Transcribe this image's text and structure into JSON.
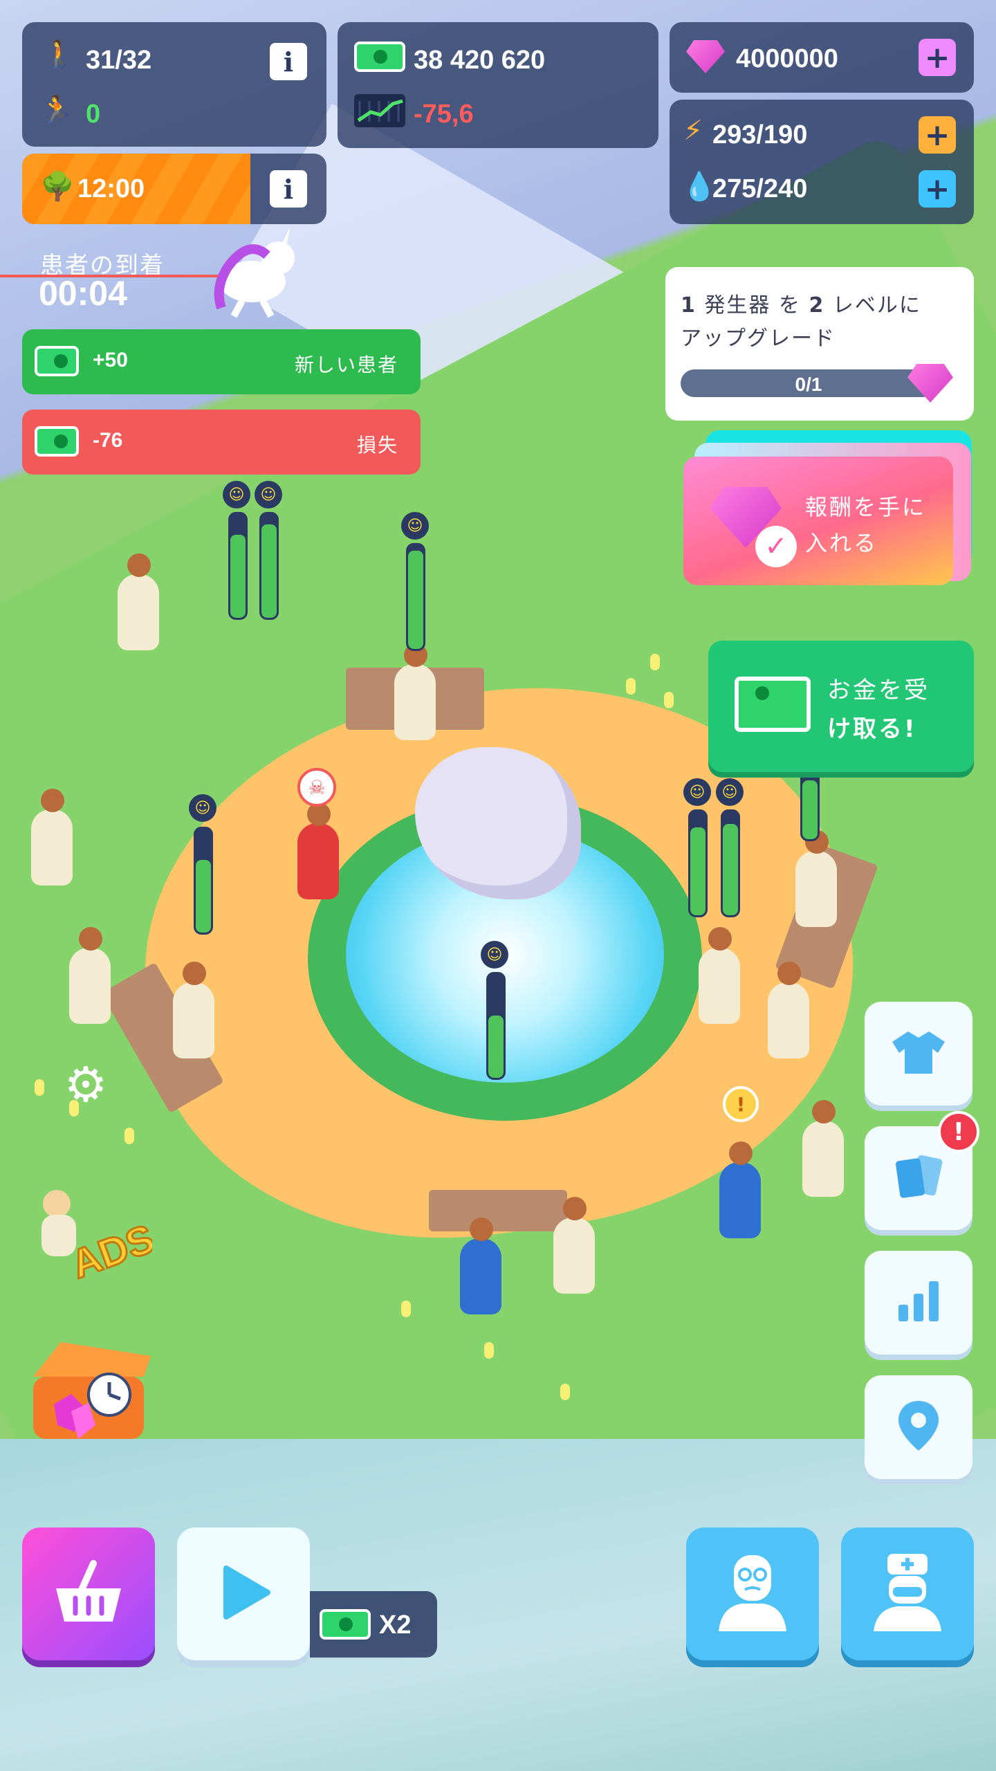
{
  "hud": {
    "patients": "31/32",
    "patients_cured": "0",
    "money": "38 420 620",
    "money_rate": "-75,6",
    "gems": "4000000",
    "energy": "293/190",
    "water": "275/240",
    "timer": "12:00",
    "info_glyph": "i",
    "plus_glyph": "+"
  },
  "arrival": {
    "label": "患者の到着",
    "time": "00:04"
  },
  "banners": {
    "new_patient_amount": "+50",
    "new_patient_label": "新しい患者",
    "loss_amount": "-76",
    "loss_label": "損失"
  },
  "quest": {
    "text_prefix": "1",
    "text_mid": " 発生器 を ",
    "text_level": "2",
    "text_suffix": " レベルに",
    "text_line2": "アップグレード",
    "progress": "0/1"
  },
  "reward": {
    "label_line1": "報酬を手に",
    "label_line2": "入れる"
  },
  "collect": {
    "label_line1": "お金を受",
    "label_line2": "け取る!"
  },
  "speed": {
    "multiplier": "X2"
  },
  "badges": {
    "alert": "!"
  },
  "colors": {
    "panel": "#283860",
    "green_banner": "#2dbb4f",
    "red_banner": "#f25a5a",
    "timer_orange": "#ff9a1f",
    "shop_magenta": "#e040d8",
    "cyan_button": "#4fc3f7"
  },
  "icons": [
    "person-icon",
    "cured-person-icon",
    "cash-icon",
    "trend-chart-icon",
    "gem-icon",
    "lightning-icon",
    "water-drop-icon",
    "tree-icon",
    "unicorn-icon",
    "shirt-icon",
    "cards-icon",
    "bar-chart-icon",
    "map-pin-icon",
    "settings-icon",
    "ads-icon",
    "gem-chest-icon",
    "basket-icon",
    "play-icon",
    "patient-icon",
    "doctor-icon",
    "skull-icon"
  ]
}
